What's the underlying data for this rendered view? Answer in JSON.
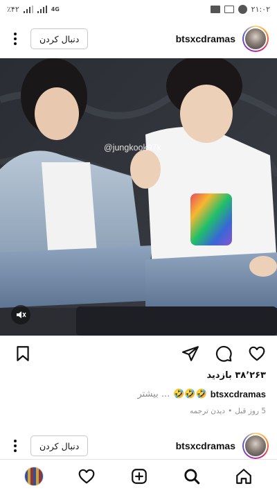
{
  "status_bar": {
    "time": "۲۱:۰۲",
    "battery": "٪۴۲",
    "network": "4G",
    "icons": [
      "whatsapp-icon",
      "image-icon",
      "folder-icon"
    ]
  },
  "post": {
    "username": "btsxcdramas",
    "follow_label": "دنبال کردن",
    "watermark": "@jungkook97k",
    "views": "۳۸٬۲۶۳ بازدید",
    "caption_user": "btsxcdramas",
    "caption_emoji": "🤣🤣🤣",
    "caption_more": "... بیشتر",
    "time_ago": "5 روز قبل",
    "separator": "•",
    "see_translation": "دیدن ترجمه"
  },
  "next_post": {
    "username": "btsxcdramas",
    "follow_label": "دنبال کردن"
  },
  "nav": {
    "items": [
      "profile-avatar",
      "activity-heart-icon",
      "create-plus-icon",
      "search-icon",
      "home-icon"
    ]
  }
}
